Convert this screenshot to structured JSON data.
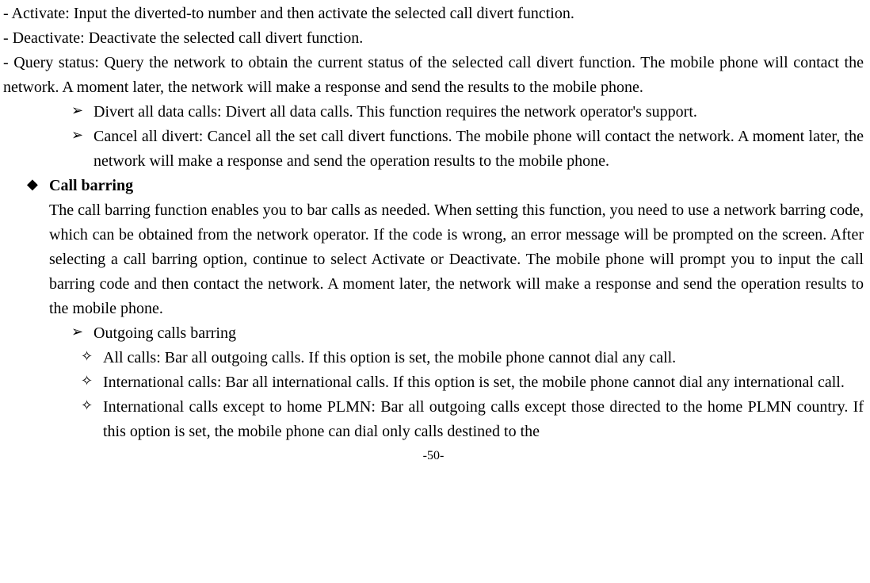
{
  "top": {
    "activate": "- Activate: Input the diverted-to number and then activate the selected call divert function.",
    "deactivate": "- Deactivate: Deactivate the selected call divert function.",
    "query": "- Query status: Query the network to obtain the current status of the selected call divert function. The mobile phone will contact the network. A moment later, the network will make a response and send the results to the mobile phone."
  },
  "chevrons": {
    "divert_all": "Divert all data calls: Divert all data calls. This function requires the network operator's support.",
    "cancel_all": "Cancel all divert: Cancel all the set call divert functions. The mobile phone will contact the network. A moment later, the network will make a response and send the operation results to the mobile phone."
  },
  "call_barring": {
    "title": "Call barring",
    "body": "The call barring function enables you to bar calls as needed. When setting this function, you need to use a network barring code, which can be obtained from the network operator. If the code is wrong, an error message will be prompted on the screen. After selecting a call barring option, continue to select Activate or Deactivate. The mobile phone will prompt you to input the call barring code and then contact the network. A moment later, the network will make a response and send the operation results to the mobile phone."
  },
  "outgoing": {
    "header": "Outgoing calls barring",
    "all_calls": "All calls: Bar all outgoing calls. If this option is set, the mobile phone cannot dial any call.",
    "intl": "International calls: Bar all international calls. If this option is set, the mobile phone cannot dial any international call.",
    "intl_except": "International calls except to home PLMN: Bar all outgoing calls except those directed to the home PLMN country. If this option is set, the mobile phone can dial only calls destined to the"
  },
  "footer": "-50-"
}
